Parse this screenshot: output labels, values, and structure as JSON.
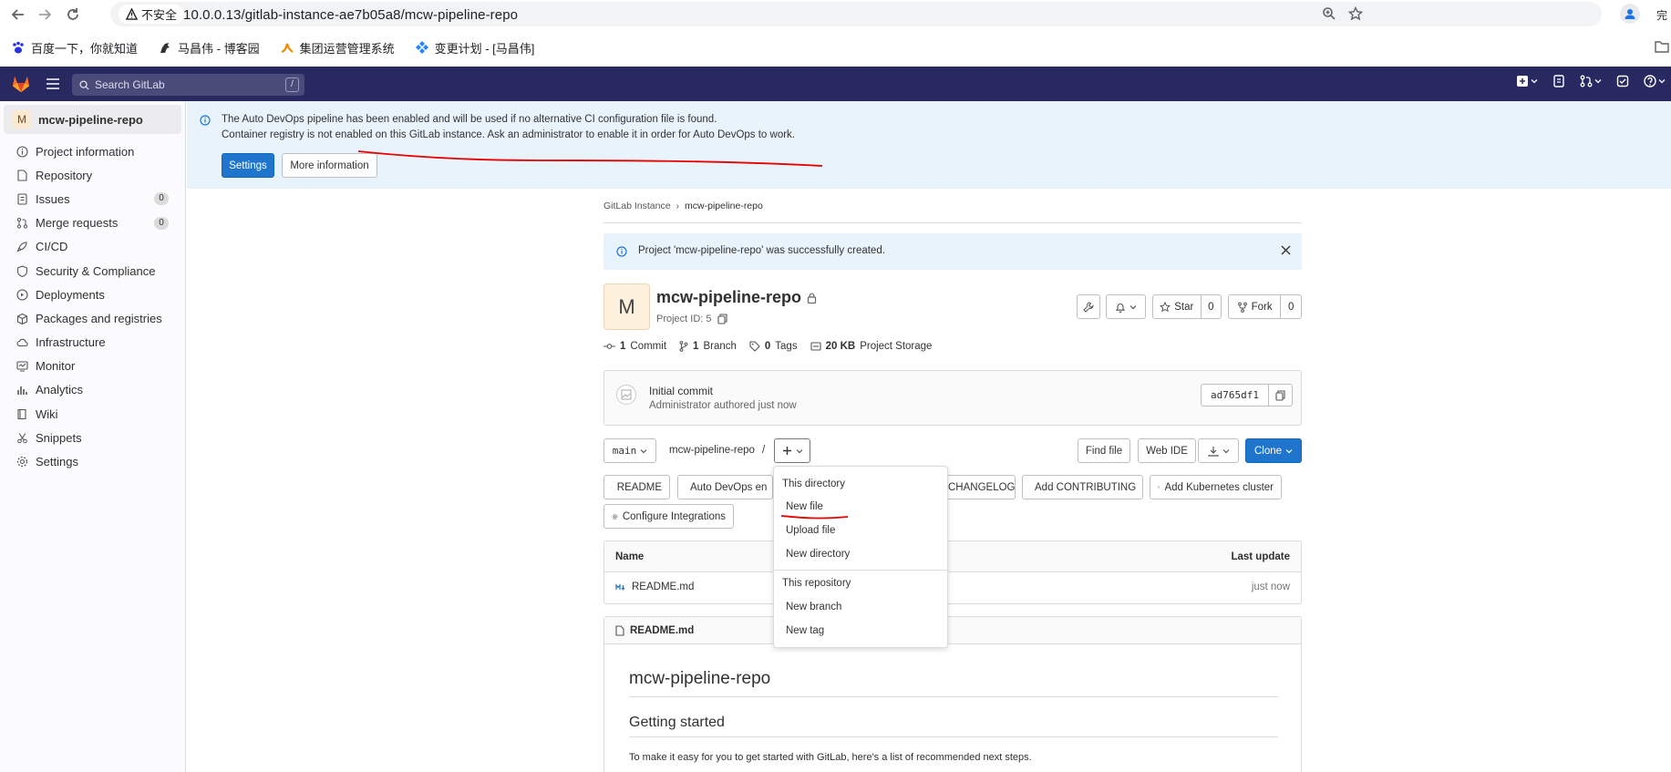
{
  "browser": {
    "security_label": "不安全",
    "url": "10.0.0.13/gitlab-instance-ae7b05a8/mcw-pipeline-repo",
    "bookmarks": [
      {
        "label": "百度一下，你就知道"
      },
      {
        "label": "马昌伟 - 博客园"
      },
      {
        "label": "集团运营管理系统"
      },
      {
        "label": "变更计划 - [马昌伟]"
      }
    ],
    "profile_fragment": "完"
  },
  "topnav": {
    "search_placeholder": "Search GitLab",
    "search_shortcut": "/"
  },
  "sidebar": {
    "context": {
      "avatar": "M",
      "name": "mcw-pipeline-repo"
    },
    "items": [
      {
        "label": "Project information",
        "icon": "info-icon"
      },
      {
        "label": "Repository",
        "icon": "doc-icon"
      },
      {
        "label": "Issues",
        "icon": "issues-icon",
        "badge": "0"
      },
      {
        "label": "Merge requests",
        "icon": "merge-request-icon",
        "badge": "0"
      },
      {
        "label": "CI/CD",
        "icon": "rocket-icon"
      },
      {
        "label": "Security & Compliance",
        "icon": "shield-icon"
      },
      {
        "label": "Deployments",
        "icon": "deployments-icon"
      },
      {
        "label": "Packages and registries",
        "icon": "package-icon"
      },
      {
        "label": "Infrastructure",
        "icon": "cloud-icon"
      },
      {
        "label": "Monitor",
        "icon": "monitor-icon"
      },
      {
        "label": "Analytics",
        "icon": "chart-icon"
      },
      {
        "label": "Wiki",
        "icon": "book-icon"
      },
      {
        "label": "Snippets",
        "icon": "snippet-icon"
      },
      {
        "label": "Settings",
        "icon": "gear-icon"
      }
    ]
  },
  "banner": {
    "line1": "The Auto DevOps pipeline has been enabled and will be used if no alternative CI configuration file is found.",
    "line2": "Container registry is not enabled on this GitLab instance. Ask an administrator to enable it in order for Auto DevOps to work.",
    "settings_label": "Settings",
    "more_info_label": "More information"
  },
  "breadcrumb": {
    "parent": "GitLab Instance",
    "current": "mcw-pipeline-repo"
  },
  "flash": {
    "message": "Project 'mcw-pipeline-repo' was successfully created."
  },
  "project": {
    "avatar": "M",
    "name": "mcw-pipeline-repo",
    "id_text": "Project ID: 5",
    "star_label": "Star",
    "star_count": "0",
    "fork_label": "Fork",
    "fork_count": "0",
    "stats": {
      "commits_num": "1",
      "commits_label": "Commit",
      "branches_num": "1",
      "branches_label": "Branch",
      "tags_num": "0",
      "tags_label": "Tags",
      "storage_num": "20 KB",
      "storage_label": "Project Storage"
    }
  },
  "commit": {
    "title": "Initial commit",
    "author": "Administrator",
    "authored": "authored just now",
    "sha": "ad765df1"
  },
  "toolbar": {
    "branch": "main",
    "path": "mcw-pipeline-repo",
    "path_sep": "/",
    "find_file": "Find file",
    "web_ide": "Web IDE",
    "clone": "Clone"
  },
  "quick_actions": {
    "readme": "README",
    "auto_devops": "Auto DevOps en",
    "changelog": "CHANGELOG",
    "contributing": "Add CONTRIBUTING",
    "kubernetes": "Add Kubernetes cluster",
    "integrations": "Configure Integrations"
  },
  "files_table": {
    "headers": {
      "name": "Name",
      "last_update": "Last update"
    },
    "rows": [
      {
        "name": "README.md",
        "last_update": "just now"
      }
    ]
  },
  "readme": {
    "filename": "README.md",
    "h1": "mcw-pipeline-repo",
    "h2": "Getting started",
    "p": "To make it easy for you to get started with GitLab, here's a list of recommended next steps."
  },
  "dropdown": {
    "section1": "This directory",
    "new_file": "New file",
    "upload_file": "Upload file",
    "new_directory": "New directory",
    "section2": "This repository",
    "new_branch": "New branch",
    "new_tag": "New tag"
  },
  "colors": {
    "gitlab_nav": "#292961",
    "primary": "#1f75cb",
    "annotation": "#e60000"
  }
}
